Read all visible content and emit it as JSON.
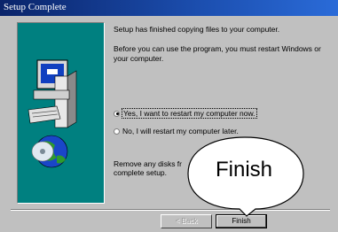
{
  "window": {
    "title": "Setup Complete"
  },
  "content": {
    "message1": "Setup has finished copying files to your computer.",
    "message2": "Before you can use the program, you must restart Windows or your computer.",
    "option_restart_yes": "Yes, I want to restart my computer now.",
    "option_restart_no": "No, I will restart my computer later.",
    "message3_part1": "Remove any disks fr",
    "message3_part2": "complete setup."
  },
  "buttons": {
    "back_label": "< Back",
    "finish_label": "Finish"
  },
  "callout": {
    "text": "Finish"
  },
  "colors": {
    "titlebar": "#0a246a",
    "banner": "#008080",
    "dialog": "#c0c0c0"
  },
  "icons": {
    "banner_art": "computer-and-globe-icon"
  }
}
